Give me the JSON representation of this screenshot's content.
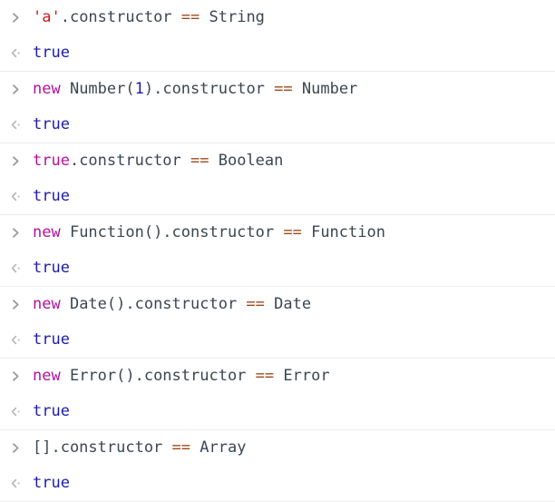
{
  "console": {
    "prompt_icon": "chevron-right-icon",
    "result_icon": "chevron-left-dot-icon",
    "colors": {
      "background": "#ffffff",
      "divider": "#ececec",
      "gutter_icon": "#9a9a9a",
      "string": "#c8201c",
      "keyword": "#b3129c",
      "number": "#1c1ca8",
      "operator": "#9c4a1c",
      "identifier": "#3b474f",
      "boolean_output": "#1c1ca8"
    },
    "entries": [
      {
        "input_tokens": [
          {
            "text": "'a'",
            "type": "string"
          },
          {
            "text": ".constructor ",
            "type": "plain"
          },
          {
            "text": "==",
            "type": "operator"
          },
          {
            "text": " String",
            "type": "plain"
          }
        ],
        "input_text": "'a'.constructor == String",
        "output_text": "true",
        "output_type": "boolean"
      },
      {
        "input_tokens": [
          {
            "text": "new",
            "type": "keyword"
          },
          {
            "text": " Number(",
            "type": "plain"
          },
          {
            "text": "1",
            "type": "number"
          },
          {
            "text": ").constructor ",
            "type": "plain"
          },
          {
            "text": "==",
            "type": "operator"
          },
          {
            "text": " Number",
            "type": "plain"
          }
        ],
        "input_text": "new Number(1).constructor == Number",
        "output_text": "true",
        "output_type": "boolean"
      },
      {
        "input_tokens": [
          {
            "text": "true",
            "type": "keyword"
          },
          {
            "text": ".constructor ",
            "type": "plain"
          },
          {
            "text": "==",
            "type": "operator"
          },
          {
            "text": " Boolean",
            "type": "plain"
          }
        ],
        "input_text": "true.constructor == Boolean",
        "output_text": "true",
        "output_type": "boolean"
      },
      {
        "input_tokens": [
          {
            "text": "new",
            "type": "keyword"
          },
          {
            "text": " Function().constructor ",
            "type": "plain"
          },
          {
            "text": "==",
            "type": "operator"
          },
          {
            "text": " Function",
            "type": "plain"
          }
        ],
        "input_text": "new Function().constructor == Function",
        "output_text": "true",
        "output_type": "boolean"
      },
      {
        "input_tokens": [
          {
            "text": "new",
            "type": "keyword"
          },
          {
            "text": " Date().constructor ",
            "type": "plain"
          },
          {
            "text": "==",
            "type": "operator"
          },
          {
            "text": " Date",
            "type": "plain"
          }
        ],
        "input_text": "new Date().constructor == Date",
        "output_text": "true",
        "output_type": "boolean"
      },
      {
        "input_tokens": [
          {
            "text": "new",
            "type": "keyword"
          },
          {
            "text": " Error().constructor ",
            "type": "plain"
          },
          {
            "text": "==",
            "type": "operator"
          },
          {
            "text": " Error",
            "type": "plain"
          }
        ],
        "input_text": "new Error().constructor == Error",
        "output_text": "true",
        "output_type": "boolean"
      },
      {
        "input_tokens": [
          {
            "text": "[].constructor ",
            "type": "plain"
          },
          {
            "text": "==",
            "type": "operator"
          },
          {
            "text": " Array",
            "type": "plain"
          }
        ],
        "input_text": "[].constructor == Array",
        "output_text": "true",
        "output_type": "boolean"
      }
    ]
  }
}
